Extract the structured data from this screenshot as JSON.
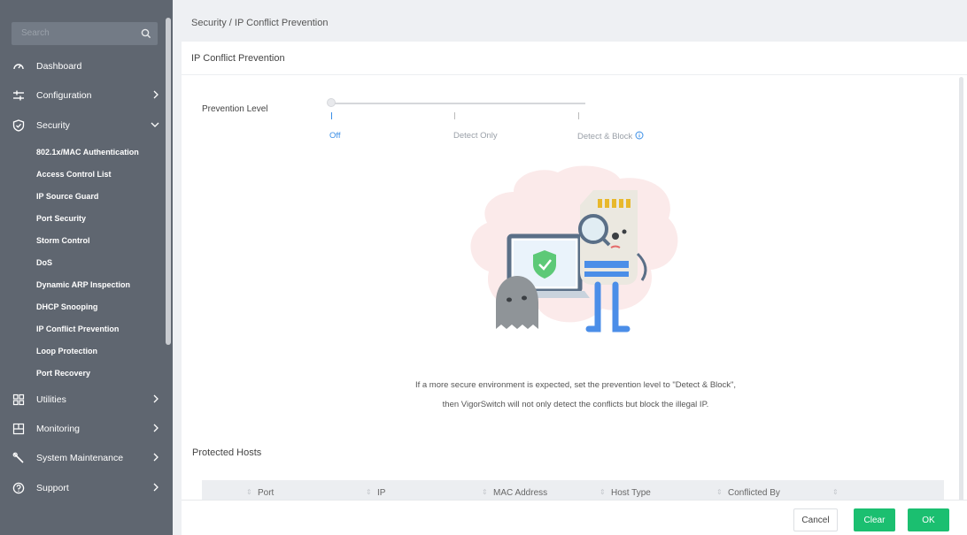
{
  "sidebar": {
    "search_placeholder": "Search",
    "items": [
      {
        "label": "Dashboard",
        "icon": "dashboard-icon"
      },
      {
        "label": "Configuration",
        "icon": "sliders-icon"
      },
      {
        "label": "Security",
        "icon": "shield-icon"
      },
      {
        "label": "Utilities",
        "icon": "grid-icon"
      },
      {
        "label": "Monitoring",
        "icon": "monitor-icon"
      },
      {
        "label": "System Maintenance",
        "icon": "wrench-icon"
      },
      {
        "label": "Support",
        "icon": "help-icon"
      }
    ],
    "security_sub": [
      "802.1x/MAC Authentication",
      "Access Control List",
      "IP Source Guard",
      "Port Security",
      "Storm Control",
      "DoS",
      "Dynamic ARP Inspection",
      "DHCP Snooping",
      "IP Conflict Prevention",
      "Loop Protection",
      "Port Recovery"
    ]
  },
  "breadcrumb": "Security / IP Conflict Prevention",
  "panel": {
    "title": "IP Conflict Prevention",
    "prevention_label": "Prevention Level",
    "levels": [
      "Off",
      "Detect Only",
      "Detect & Block"
    ],
    "selected_level": "Off",
    "message_line1": "If a more secure environment is expected, set the prevention level to \"Detect & Block\",",
    "message_line2": "then VigorSwitch will not only detect the conflicts but block the illegal IP.",
    "protected_hosts_title": "Protected Hosts",
    "columns": [
      "Port",
      "IP",
      "MAC Address",
      "Host Type",
      "Conflicted By"
    ]
  },
  "footer": {
    "cancel": "Cancel",
    "clear": "Clear",
    "ok": "OK"
  },
  "colors": {
    "sidebar_bg": "#5f6670",
    "accent_blue": "#3a8ee6",
    "accent_green": "#1bbf70"
  }
}
